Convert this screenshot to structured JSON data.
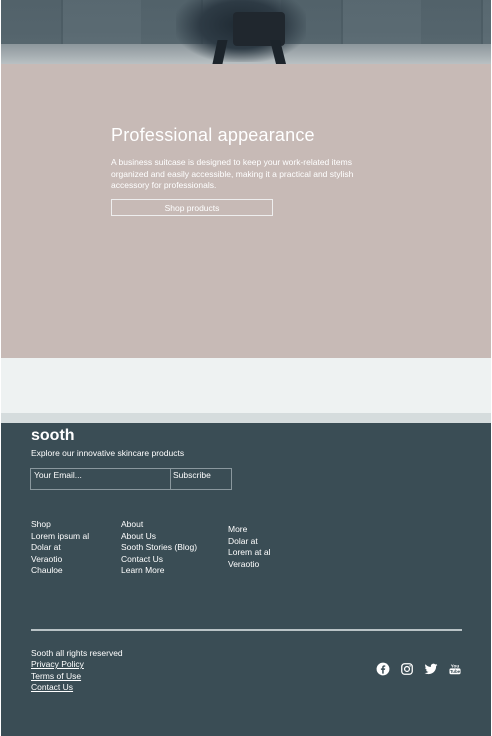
{
  "promo": {
    "title": "Professional appearance",
    "text": "A business suitcase is designed to keep your work-related items organized and easily accessible, making it a practical and stylish accessory for professionals.",
    "button_label": "Shop products"
  },
  "footer": {
    "brand": "sooth",
    "tagline": "Explore our innovative skincare products",
    "email_placeholder": "Your Email...",
    "subscribe_label": "Subscribe",
    "columns": [
      {
        "items": [
          "Shop",
          "Lorem ipsum al",
          "Dolar at",
          "Veraotio",
          "Chauloe"
        ]
      },
      {
        "items": [
          "About",
          "About Us",
          "Sooth Stories (Blog)",
          "Contact Us",
          "Learn More"
        ]
      },
      {
        "items": [
          "More",
          "Dolar at",
          "Lorem at al",
          "Veraotio"
        ]
      }
    ],
    "copyright": "Sooth all rights reserved",
    "legal_links": [
      "Privacy Policy",
      "Terms of Use",
      "Contact Us"
    ],
    "social_icons": [
      "facebook-icon",
      "instagram-icon",
      "twitter-icon",
      "youtube-icon"
    ]
  },
  "colors": {
    "promo_bg": "#c7bab6",
    "band_bg": "#eef2f2",
    "footer_bg": "#3a4d55"
  }
}
